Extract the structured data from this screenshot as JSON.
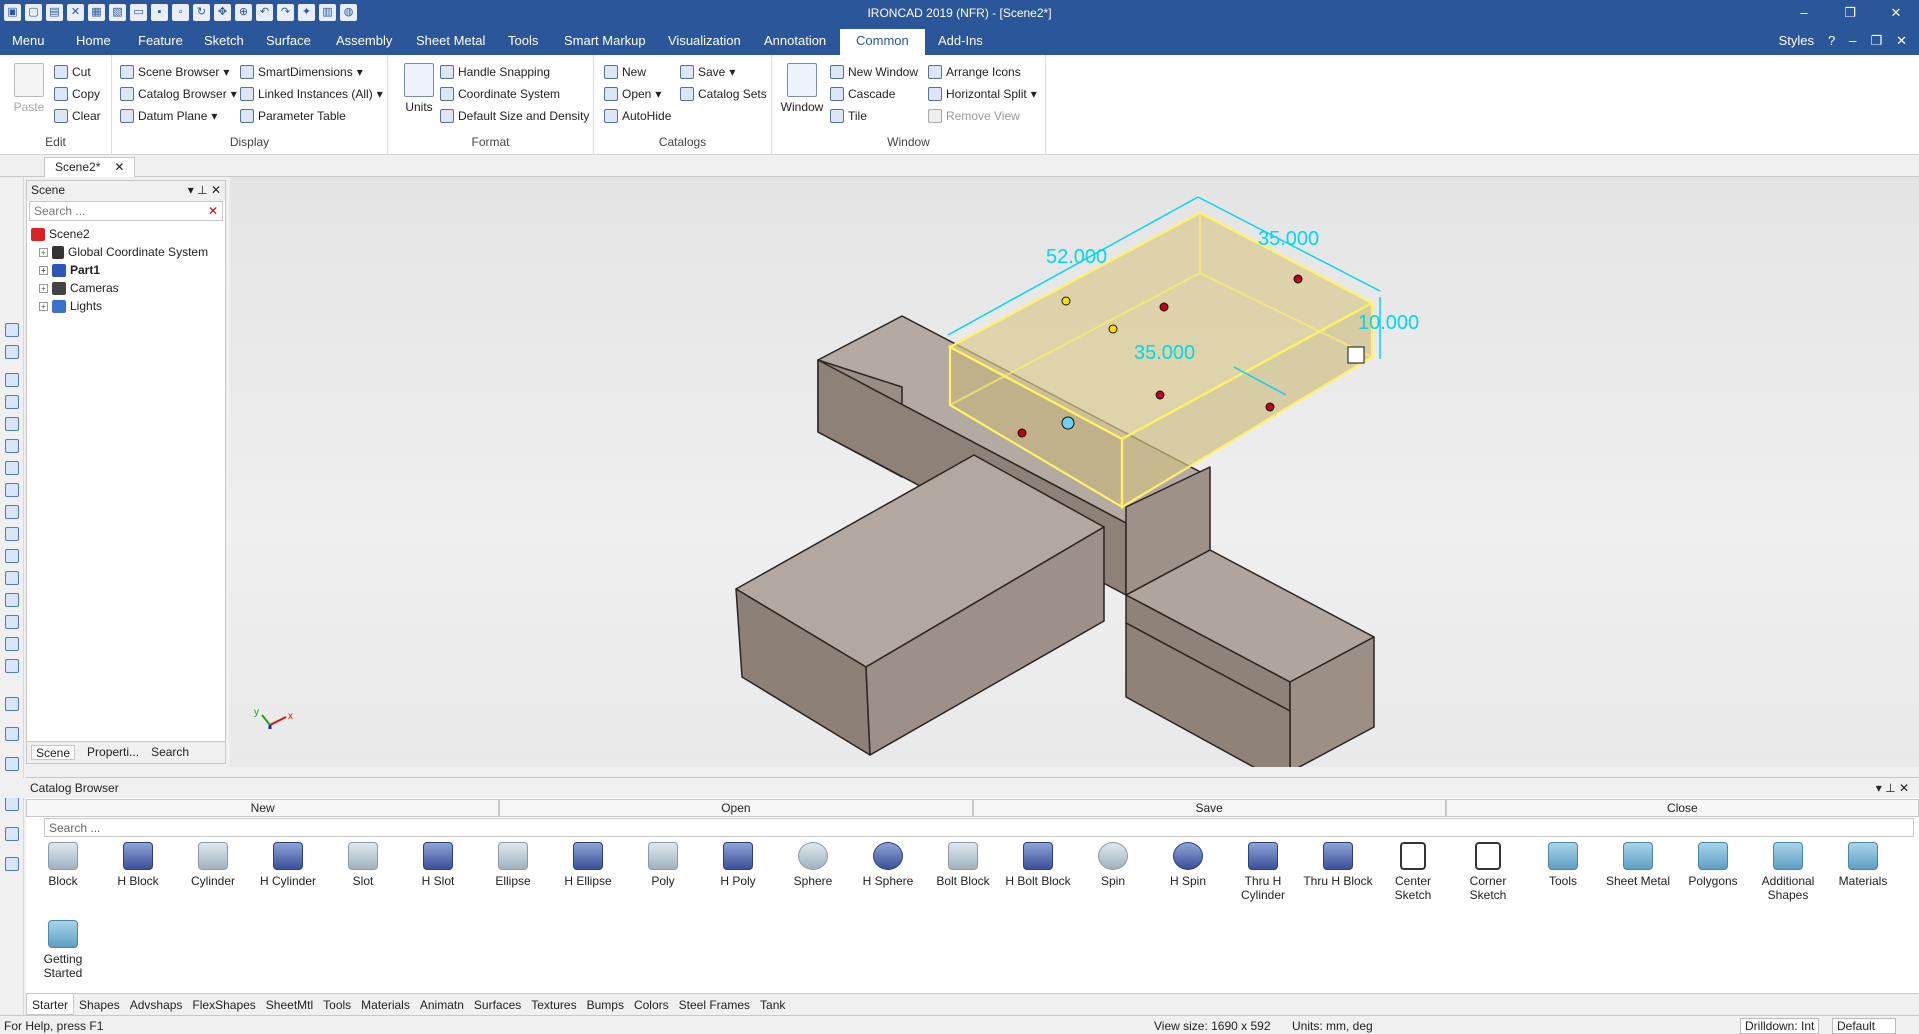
{
  "window": {
    "title": "IRONCAD 2019 (NFR) - [Scene2*]",
    "controls": [
      "–",
      "❐",
      "✕"
    ]
  },
  "menu_tabs": [
    "Menu",
    "Home",
    "Feature",
    "Sketch",
    "Surface",
    "Assembly",
    "Sheet Metal",
    "Tools",
    "Smart Markup",
    "Visualization",
    "Annotation",
    "Common",
    "Add-Ins"
  ],
  "active_tab": "Common",
  "styles_label": "Styles",
  "ribbon": {
    "edit": {
      "label": "Edit",
      "paste": "Paste",
      "cut": "Cut",
      "copy": "Copy",
      "clear": "Clear"
    },
    "display": {
      "label": "Display",
      "scene_browser": "Scene Browser",
      "catalog_browser": "Catalog Browser",
      "datum_plane": "Datum Plane",
      "smart_dimensions": "SmartDimensions",
      "linked_instances": "Linked Instances (All)",
      "parameter_table": "Parameter Table"
    },
    "format": {
      "label": "Format",
      "units": "Units",
      "handle_snapping": "Handle Snapping",
      "coordinate_system": "Coordinate System",
      "default_size": "Default Size and Density"
    },
    "catalogs": {
      "label": "Catalogs",
      "new": "New",
      "open": "Open",
      "autohide": "AutoHide",
      "save": "Save",
      "catalog_sets": "Catalog Sets"
    },
    "window": {
      "label": "Window",
      "window": "Window",
      "new_window": "New Window",
      "cascade": "Cascade",
      "tile": "Tile",
      "arrange_icons": "Arrange Icons",
      "horizontal_split": "Horizontal Split",
      "remove_view": "Remove View"
    }
  },
  "doc_tab": {
    "name": "Scene2*",
    "close": "✕"
  },
  "scene_panel": {
    "title": "Scene",
    "search_placeholder": "Search ...",
    "tree": [
      {
        "label": "Scene2",
        "bold": false
      },
      {
        "label": "Global Coordinate System",
        "bold": false
      },
      {
        "label": "Part1",
        "bold": true
      },
      {
        "label": "Cameras",
        "bold": false
      },
      {
        "label": "Lights",
        "bold": false
      }
    ],
    "tabs": [
      "Scene",
      "Properti...",
      "Search"
    ]
  },
  "viewport": {
    "dimensions": [
      "52.000",
      "35.000",
      "35.000",
      "10.000"
    ],
    "triad": {
      "x": "x",
      "y": "y"
    },
    "colors": {
      "part": "#a89a8e",
      "part_dark": "#8f8278",
      "part_light": "#b7aca3",
      "selection": "#fff266",
      "dimension": "#00d8f0",
      "handle": "#c00018"
    }
  },
  "catalog": {
    "title": "Catalog Browser",
    "buttons": [
      "New",
      "Open",
      "Save",
      "Close"
    ],
    "search_placeholder": "Search ...",
    "items": [
      {
        "label": "Block",
        "kind": "shape"
      },
      {
        "label": "H Block",
        "kind": "h"
      },
      {
        "label": "Cylinder",
        "kind": "shape"
      },
      {
        "label": "H Cylinder",
        "kind": "h"
      },
      {
        "label": "Slot",
        "kind": "shape"
      },
      {
        "label": "H Slot",
        "kind": "h"
      },
      {
        "label": "Ellipse",
        "kind": "shape"
      },
      {
        "label": "H Ellipse",
        "kind": "h"
      },
      {
        "label": "Poly",
        "kind": "shape"
      },
      {
        "label": "H Poly",
        "kind": "h"
      },
      {
        "label": "Sphere",
        "kind": "shape"
      },
      {
        "label": "H Sphere",
        "kind": "h"
      },
      {
        "label": "Bolt Block",
        "kind": "shape"
      },
      {
        "label": "H Bolt Block",
        "kind": "h"
      },
      {
        "label": "Spin",
        "kind": "shape"
      },
      {
        "label": "H Spin",
        "kind": "h"
      },
      {
        "label": "Thru H Cylinder",
        "kind": "h"
      },
      {
        "label": "Thru H Block",
        "kind": "h"
      },
      {
        "label": "Center Sketch",
        "kind": "sketch"
      },
      {
        "label": "Corner Sketch",
        "kind": "sketch"
      },
      {
        "label": "Tools",
        "kind": "folder"
      },
      {
        "label": "Sheet Metal",
        "kind": "folder"
      },
      {
        "label": "Polygons",
        "kind": "folder"
      },
      {
        "label": "Additional Shapes",
        "kind": "folder"
      },
      {
        "label": "Materials",
        "kind": "folder"
      },
      {
        "label": "Getting Started",
        "kind": "folder"
      }
    ],
    "tabs": [
      "Starter",
      "Shapes",
      "Advshaps",
      "FlexShapes",
      "SheetMtl",
      "Tools",
      "Materials",
      "Animatn",
      "Surfaces",
      "Textures",
      "Bumps",
      "Colors",
      "Steel Frames",
      "Tank"
    ]
  },
  "status": {
    "help": "For Help, press F1",
    "view_size": "View size: 1690 x 592",
    "units": "Units: mm, deg",
    "drilldown": "Drilldown: Int",
    "style": "Default"
  }
}
